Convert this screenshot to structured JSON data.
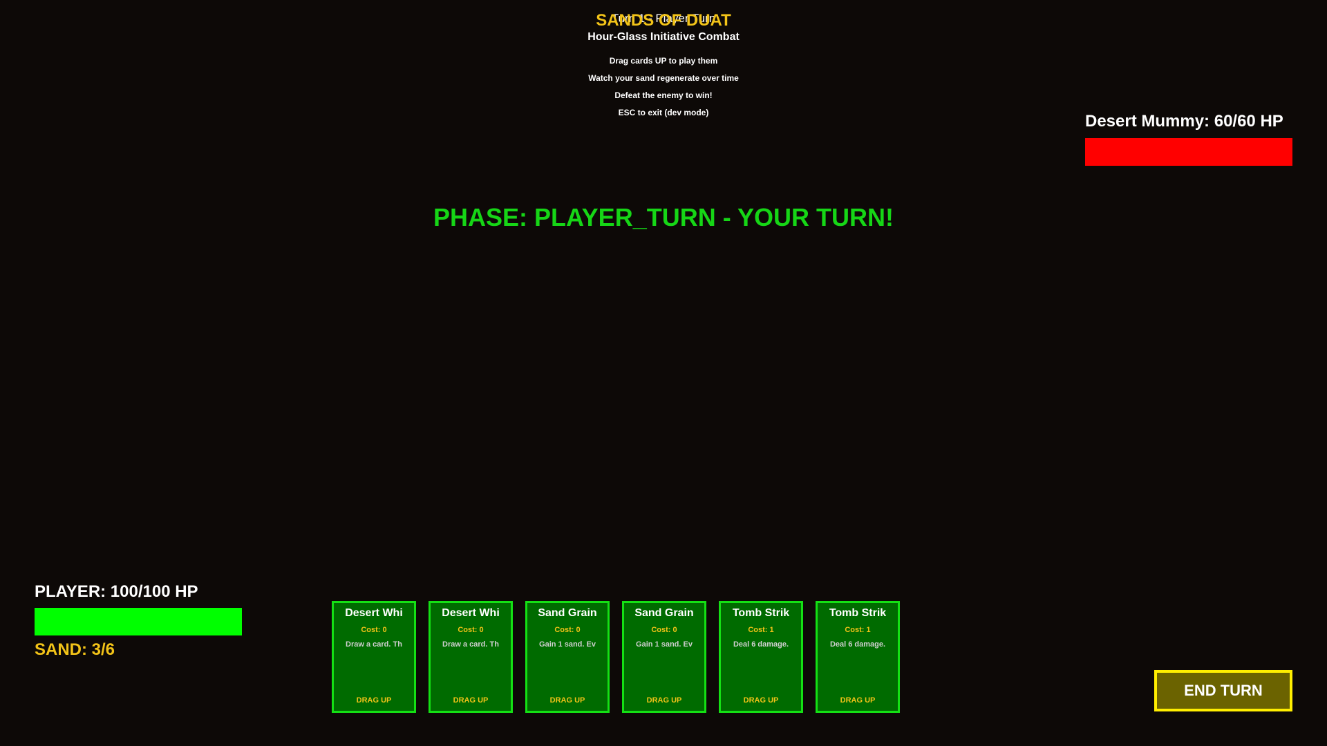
{
  "header": {
    "turn_label": "Turn 1 - Player Turn",
    "title": "SANDS OF DUAT",
    "subtitle": "Hour-Glass Initiative Combat",
    "instructions": [
      "Drag cards UP to play them",
      "Watch your sand regenerate over time",
      "Defeat the enemy to win!",
      "ESC to exit (dev mode)"
    ]
  },
  "phase": {
    "text": "PHASE: PLAYER_TURN - YOUR TURN!",
    "color": "#16d616"
  },
  "enemy": {
    "label": "Desert Mummy: 60/60 HP",
    "hp": 60,
    "max_hp": 60,
    "bar_color": "#ff0000"
  },
  "player": {
    "label": "PLAYER: 100/100 HP",
    "hp": 100,
    "max_hp": 100,
    "bar_color": "#00ff00",
    "sand_label": "SAND: 3/6",
    "sand": 3,
    "max_sand": 6
  },
  "hand": [
    {
      "name": "Desert Whi",
      "cost": "Cost: 0",
      "desc": "Draw a card. Th",
      "hint": "DRAG UP"
    },
    {
      "name": "Desert Whi",
      "cost": "Cost: 0",
      "desc": "Draw a card. Th",
      "hint": "DRAG UP"
    },
    {
      "name": "Sand Grain",
      "cost": "Cost: 0",
      "desc": "Gain 1 sand. Ev",
      "hint": "DRAG UP"
    },
    {
      "name": "Sand Grain",
      "cost": "Cost: 0",
      "desc": "Gain 1 sand. Ev",
      "hint": "DRAG UP"
    },
    {
      "name": "Tomb Strik",
      "cost": "Cost: 1",
      "desc": "Deal 6 damage.",
      "hint": "DRAG UP"
    },
    {
      "name": "Tomb Strik",
      "cost": "Cost: 1",
      "desc": "Deal 6 damage.",
      "hint": "DRAG UP"
    }
  ],
  "end_turn": {
    "label": "END TURN"
  },
  "colors": {
    "background": "#0d0907",
    "gold": "#f2c318",
    "card_fill": "#006b00",
    "card_border": "#14e014"
  }
}
